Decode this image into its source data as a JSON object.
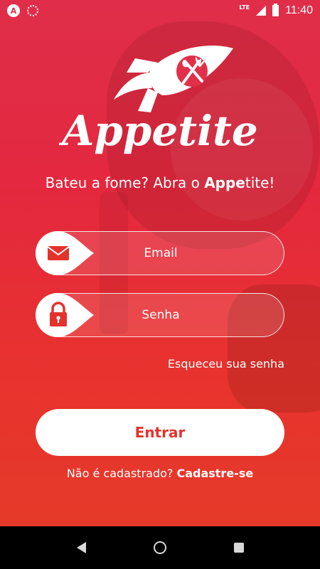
{
  "status_bar": {
    "app_icon_letter": "A",
    "network": "LTE",
    "time": "11:40"
  },
  "logo": {
    "name": "Appetite"
  },
  "tagline": {
    "prefix": "Bateu a fome? Abra o ",
    "brand_bold": "Appe",
    "brand_rest": "tite!"
  },
  "form": {
    "email_placeholder": "Email",
    "senha_placeholder": "Senha",
    "forgot_link": "Esqueceu sua senha",
    "submit_label": "Entrar"
  },
  "signup": {
    "question": "Não é cadastrado? ",
    "link": "Cadastre-se"
  },
  "colors": {
    "brand_red": "#e3283f",
    "button_text": "#e4332c",
    "white": "#ffffff"
  },
  "icons": {
    "email": "envelope-icon",
    "senha": "lock-icon",
    "logo": "rocket-icon"
  }
}
